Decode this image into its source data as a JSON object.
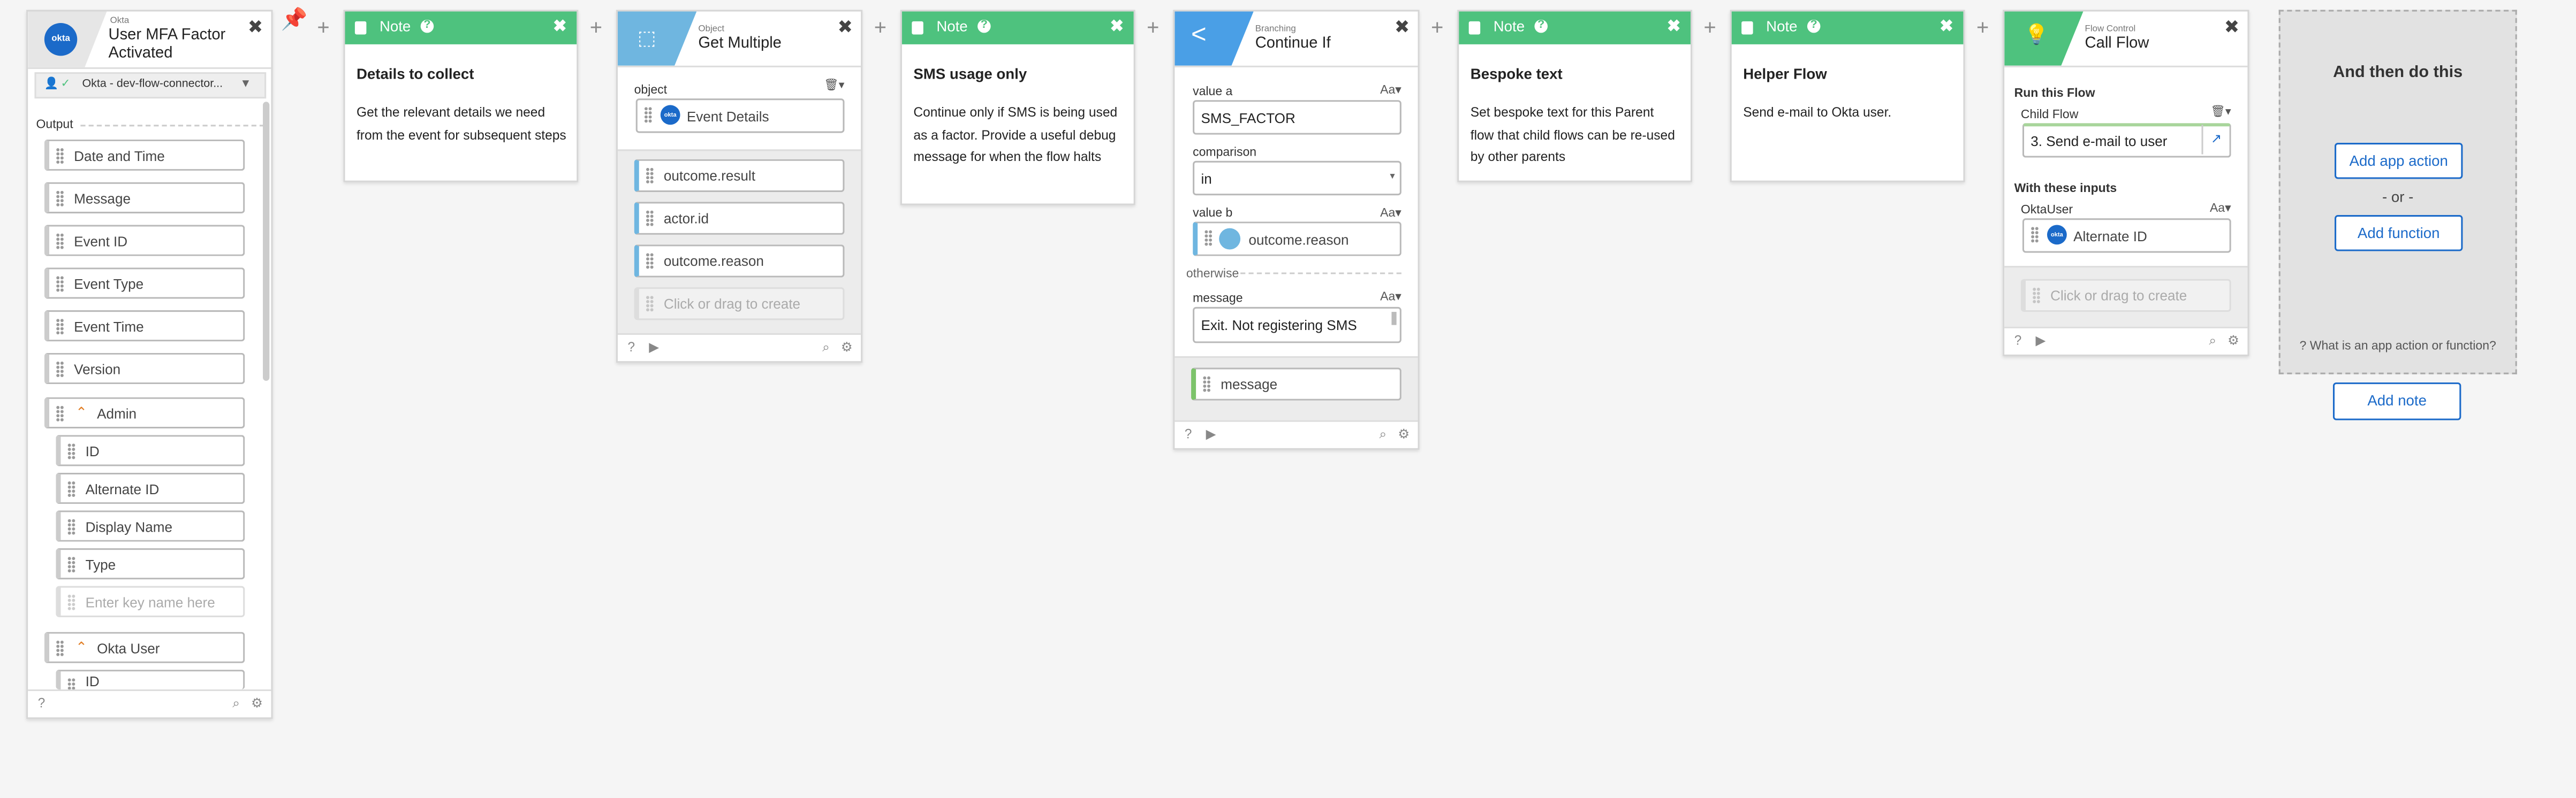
{
  "trigger": {
    "app_label": "Okta",
    "title_line1": "User MFA Factor",
    "title_line2": "Activated",
    "connection": "Okta - dev-flow-connector...",
    "output_label": "Output",
    "fields": [
      "Date and Time",
      "Message",
      "Event ID",
      "Event Type",
      "Event Time",
      "Version"
    ],
    "admin_label": "Admin",
    "admin_fields": [
      "ID",
      "Alternate ID",
      "Display Name",
      "Type"
    ],
    "key_placeholder": "Enter key name here",
    "okta_user_label": "Okta User",
    "okta_user_fields": [
      "ID"
    ]
  },
  "note1": {
    "label": "Note",
    "title": "Details to collect",
    "body": "Get the relevant details we need from the event for subsequent steps"
  },
  "get_multiple": {
    "category": "Object",
    "title": "Get Multiple",
    "object_label": "object",
    "object_value": "Event Details",
    "outputs": [
      "outcome.result",
      "actor.id",
      "outcome.reason"
    ],
    "create_placeholder": "Click or drag to create"
  },
  "note2": {
    "label": "Note",
    "title": "SMS usage only",
    "body": "Continue only if SMS is being used as a factor. Provide a useful debug message for when the flow halts"
  },
  "continue_if": {
    "category": "Branching",
    "title": "Continue If",
    "value_a_label": "value a",
    "value_a": "SMS_FACTOR",
    "comparison_label": "comparison",
    "comparison_value": "in",
    "value_b_label": "value b",
    "value_b": "outcome.reason",
    "otherwise_label": "otherwise",
    "message_label": "message",
    "message_value": "Exit. Not registering SMS",
    "message_output": "message",
    "type_label": "Aa"
  },
  "note3": {
    "label": "Note",
    "title": "Bespoke text",
    "body": "Set bespoke text for this Parent flow that child flows can be re-used by other parents"
  },
  "note4": {
    "label": "Note",
    "title": "Helper Flow",
    "body": "Send e-mail to Okta user."
  },
  "call_flow": {
    "category": "Flow Control",
    "title": "Call Flow",
    "run_label": "Run this Flow",
    "child_label": "Child Flow",
    "child_value": "3. Send e-mail to user",
    "inputs_label": "With these inputs",
    "input_name": "OktaUser",
    "input_value": "Alternate ID",
    "create_placeholder": "Click or drag to create",
    "type_label": "Aa"
  },
  "next_step": {
    "title": "And then do this",
    "add_app_action": "Add app action",
    "or_label": "- or -",
    "add_function": "Add function",
    "help_text": "What is an app action or function?",
    "add_note": "Add note"
  },
  "colors": {
    "note_green": "#4ec27e",
    "okta_blue": "#1b6ac9",
    "object_blue": "#6fb6e0",
    "branch_blue": "#4a9fe6"
  }
}
